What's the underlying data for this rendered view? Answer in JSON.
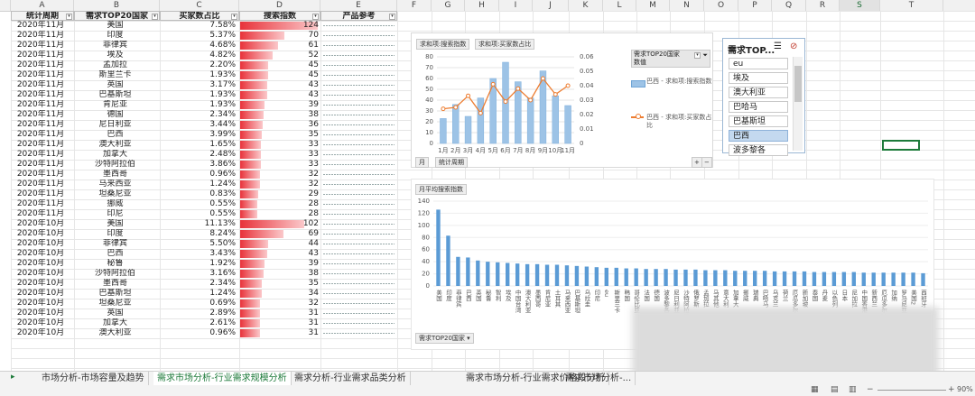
{
  "columns": [
    "A",
    "B",
    "C",
    "D",
    "E",
    "F",
    "G",
    "H",
    "I",
    "J",
    "K",
    "L",
    "M",
    "N",
    "O",
    "P",
    "Q",
    "R",
    "S",
    "T"
  ],
  "selected_column": "S",
  "table": {
    "headers": [
      "统计周期",
      "需求TOP20国家",
      "买家数占比",
      "搜索指数",
      "产品参考"
    ],
    "rows": [
      [
        "2020年11月",
        "美国",
        "7.58%",
        124
      ],
      [
        "2020年11月",
        "印度",
        "5.37%",
        70
      ],
      [
        "2020年11月",
        "菲律宾",
        "4.68%",
        61
      ],
      [
        "2020年11月",
        "埃及",
        "4.82%",
        52
      ],
      [
        "2020年11月",
        "孟加拉",
        "2.20%",
        45
      ],
      [
        "2020年11月",
        "斯里兰卡",
        "1.93%",
        45
      ],
      [
        "2020年11月",
        "英国",
        "3.17%",
        43
      ],
      [
        "2020年11月",
        "巴基斯坦",
        "1.93%",
        43
      ],
      [
        "2020年11月",
        "肯尼亚",
        "1.93%",
        39
      ],
      [
        "2020年11月",
        "德国",
        "2.34%",
        38
      ],
      [
        "2020年11月",
        "尼日利亚",
        "3.44%",
        36
      ],
      [
        "2020年11月",
        "巴西",
        "3.99%",
        35
      ],
      [
        "2020年11月",
        "澳大利亚",
        "1.65%",
        33
      ],
      [
        "2020年11月",
        "加拿大",
        "2.48%",
        33
      ],
      [
        "2020年11月",
        "沙特阿拉伯",
        "3.86%",
        33
      ],
      [
        "2020年11月",
        "墨西哥",
        "0.96%",
        32
      ],
      [
        "2020年11月",
        "马来西亚",
        "1.24%",
        32
      ],
      [
        "2020年11月",
        "坦桑尼亚",
        "0.83%",
        29
      ],
      [
        "2020年11月",
        "挪威",
        "0.55%",
        28
      ],
      [
        "2020年11月",
        "印尼",
        "0.55%",
        28
      ],
      [
        "2020年10月",
        "美国",
        "11.13%",
        102
      ],
      [
        "2020年10月",
        "印度",
        "8.24%",
        69
      ],
      [
        "2020年10月",
        "菲律宾",
        "5.50%",
        44
      ],
      [
        "2020年10月",
        "巴西",
        "3.43%",
        43
      ],
      [
        "2020年10月",
        "秘鲁",
        "1.92%",
        39
      ],
      [
        "2020年10月",
        "沙特阿拉伯",
        "3.16%",
        38
      ],
      [
        "2020年10月",
        "墨西哥",
        "2.34%",
        35
      ],
      [
        "2020年10月",
        "巴基斯坦",
        "1.24%",
        34
      ],
      [
        "2020年10月",
        "坦桑尼亚",
        "0.69%",
        32
      ],
      [
        "2020年10月",
        "英国",
        "2.89%",
        31
      ],
      [
        "2020年10月",
        "加拿大",
        "2.61%",
        31
      ],
      [
        "2020年10月",
        "澳大利亚",
        "0.96%",
        31
      ]
    ]
  },
  "chart1": {
    "chips": [
      "求和项:搜索指数",
      "求和项:买家数占比"
    ],
    "legend_header": "需求TOP20国家",
    "legend_sub": "数值",
    "legend_items": [
      "巴西 - 求和项:搜索指数",
      "巴西 - 求和项:买家数占比"
    ],
    "field_buttons": [
      "月",
      "统计周期"
    ],
    "plus_minus": [
      "+",
      "−"
    ],
    "bar_color": "#9dc3e6",
    "line_color": "#ed7d31"
  },
  "chart2": {
    "chip": "月平均搜索指数",
    "field_button": "需求TOP20国家",
    "bar_color": "#5b9bd5"
  },
  "chart_data": [
    {
      "type": "bar",
      "categories": [
        "1月",
        "2月",
        "3月",
        "4月",
        "5月",
        "6月",
        "7月",
        "8月",
        "9月",
        "10月",
        "11月"
      ],
      "series": [
        {
          "name": "巴西 - 求和项:搜索指数",
          "values": [
            23,
            36,
            25,
            42,
            60,
            75,
            57,
            42,
            67,
            44,
            35
          ]
        },
        {
          "name": "巴西 - 求和项:买家数占比",
          "values": [
            0.024,
            0.025,
            0.033,
            0.021,
            0.041,
            0.029,
            0.038,
            0.03,
            0.045,
            0.034,
            0.04
          ]
        }
      ],
      "ylim": [
        0,
        80
      ],
      "y2lim": [
        0,
        0.06
      ],
      "yticks": [
        0,
        10,
        20,
        30,
        40,
        50,
        60,
        70,
        80
      ],
      "y2ticks": [
        "0",
        "0.01",
        "0.02",
        "0.03",
        "0.04",
        "0.05",
        "0.06"
      ]
    },
    {
      "type": "bar",
      "categories": [
        "美国",
        "印度",
        "菲律宾",
        "巴西",
        "英国",
        "秘鲁",
        "智利",
        "埃及",
        "中国台湾",
        "澳大利亚",
        "墨西哥",
        "肯尼亚",
        "土耳其",
        "马来西亚",
        "巴基斯坦",
        "乌拉圭",
        "印尼",
        "eu",
        "斯里兰卡",
        "韩国",
        "哥伦比亚",
        "法国",
        "德国",
        "波多黎各",
        "尼日利亚",
        "沙特阿拉伯",
        "俄罗斯",
        "孟加拉",
        "马其他",
        "意大利",
        "加拿大",
        "挪威",
        "瑞典",
        "巴哈马",
        "乌克兰",
        "荷兰",
        "厄瓜多尔",
        "新加坡",
        "泰国",
        "丹麦",
        "以色列",
        "日本",
        "尼加拉",
        "中国香港",
        "新西兰",
        "厄瓜多尔2",
        "加纳",
        "罗马尼亚",
        "美国2",
        "西班牙"
      ],
      "values": [
        126,
        83,
        48,
        47,
        42,
        40,
        39,
        38,
        37,
        36,
        36,
        35,
        35,
        34,
        33,
        32,
        31,
        30,
        30,
        29,
        29,
        28,
        28,
        28,
        27,
        27,
        27,
        26,
        26,
        26,
        25,
        25,
        25,
        25,
        24,
        24,
        24,
        24,
        23,
        23,
        23,
        23,
        23,
        22,
        22,
        22,
        22,
        22,
        22,
        21
      ],
      "ylim": [
        0,
        140
      ],
      "yticks": [
        0,
        20,
        40,
        60,
        80,
        100,
        120,
        140
      ]
    }
  ],
  "slicer": {
    "title": "需求TOP...",
    "items": [
      "eu",
      "埃及",
      "澳大利亚",
      "巴哈马",
      "巴基斯坦",
      "巴西",
      "波多黎各"
    ],
    "selected": "巴西"
  },
  "tabs": [
    "市场分析-市场容量及趋势",
    "需求市场分析-行业需求规模分析",
    "需求分析-行业需求品类分析",
    "需求市场分析-行业需求价格段分析",
    "需求市场分析-..."
  ],
  "active_tab": 1,
  "status": {
    "zoom": "90%"
  }
}
